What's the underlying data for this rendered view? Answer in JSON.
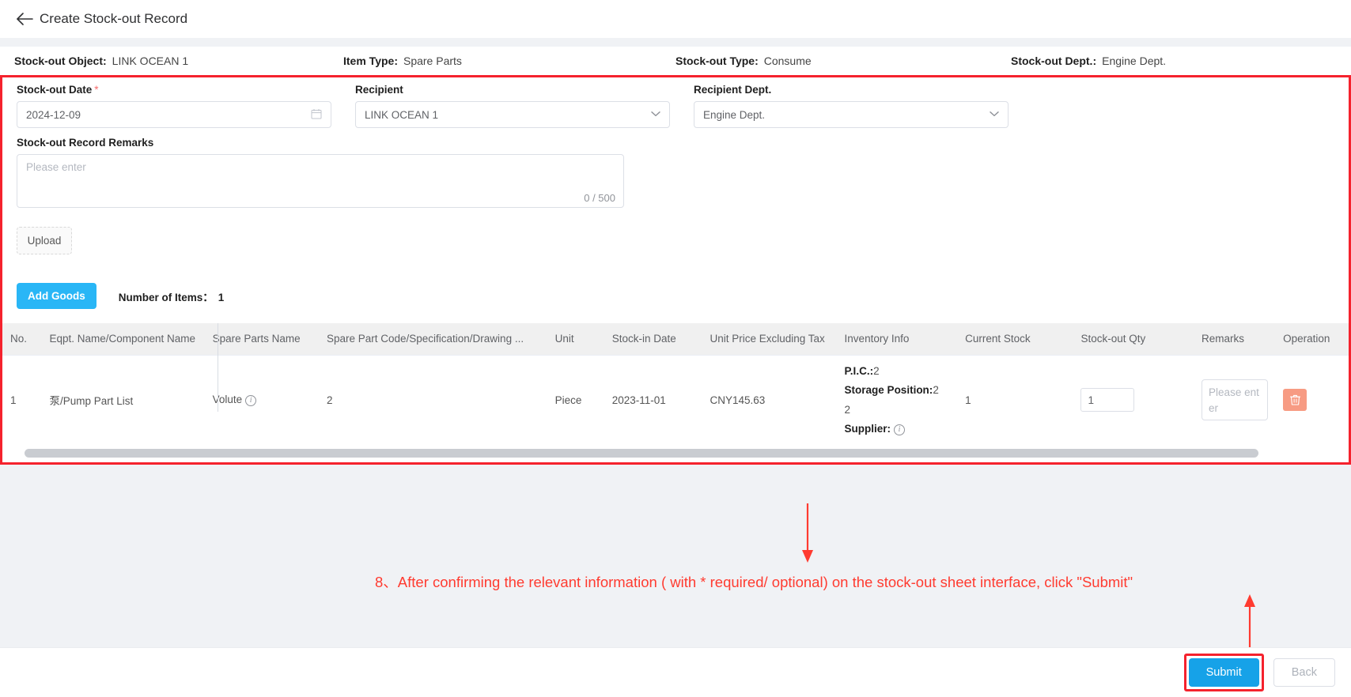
{
  "header": {
    "back_icon": "arrow-left-icon",
    "title": "Create Stock-out Record"
  },
  "summary": [
    {
      "label": "Stock-out Object:",
      "value": "LINK OCEAN 1"
    },
    {
      "label": "Item Type:",
      "value": "Spare Parts"
    },
    {
      "label": "Stock-out Type:",
      "value": "Consume"
    },
    {
      "label": "Stock-out Dept.:",
      "value": "Engine Dept."
    }
  ],
  "form": {
    "date": {
      "label": "Stock-out Date",
      "required_marker": "*",
      "value": "2024-12-09",
      "icon": "calendar-icon"
    },
    "recipient": {
      "label": "Recipient",
      "value": "LINK OCEAN 1",
      "icon": "chevron-down-icon"
    },
    "recipient_dept": {
      "label": "Recipient Dept.",
      "value": "Engine Dept.",
      "icon": "chevron-down-icon"
    },
    "remarks": {
      "label": "Stock-out Record Remarks",
      "placeholder": "Please enter",
      "value": "",
      "counter": "0 / 500"
    },
    "upload_label": "Upload"
  },
  "goods": {
    "add_button": "Add Goods",
    "count_label": "Number of Items：",
    "count_value": "1",
    "columns": [
      "No.",
      "Eqpt. Name/Component Name",
      "Spare Parts Name",
      "Spare Part Code/Specification/Drawing ...",
      "Unit",
      "Stock-in Date",
      "Unit Price Excluding Tax",
      "Inventory Info",
      "Current Stock",
      "Stock-out Qty",
      "Remarks",
      "Operation"
    ],
    "rows": [
      {
        "no": "1",
        "eqpt_name": "泵/Pump Part List",
        "spare_parts_name": "Volute",
        "spare_parts_name_icon": "info-icon",
        "spare_part_code": "2",
        "unit": "Piece",
        "stock_in_date": "2023-11-01",
        "unit_price": "CNY145.63",
        "inventory": {
          "pic_label": "P.I.C.:",
          "pic_value": "2",
          "storage_label": "Storage Position:",
          "storage_value": "2",
          "storage_value_2": "2",
          "supplier_label": "Supplier:",
          "supplier_icon": "info-icon"
        },
        "current_stock": "1",
        "stock_out_qty": "1",
        "remarks_placeholder": "Please enter",
        "delete_icon": "trash-icon"
      }
    ]
  },
  "annotation": {
    "text": "8、After confirming the relevant information ( with * required/ optional) on the stock-out sheet interface, click \"Submit\"",
    "color": "#ff3b30"
  },
  "footer": {
    "submit_label": "Submit",
    "back_label": "Back"
  },
  "colors": {
    "accent": "#16a2e8",
    "add_goods": "#29b6f6",
    "highlight": "#f5222d",
    "danger": "#f79b83",
    "page_bg": "#f0f2f5"
  }
}
